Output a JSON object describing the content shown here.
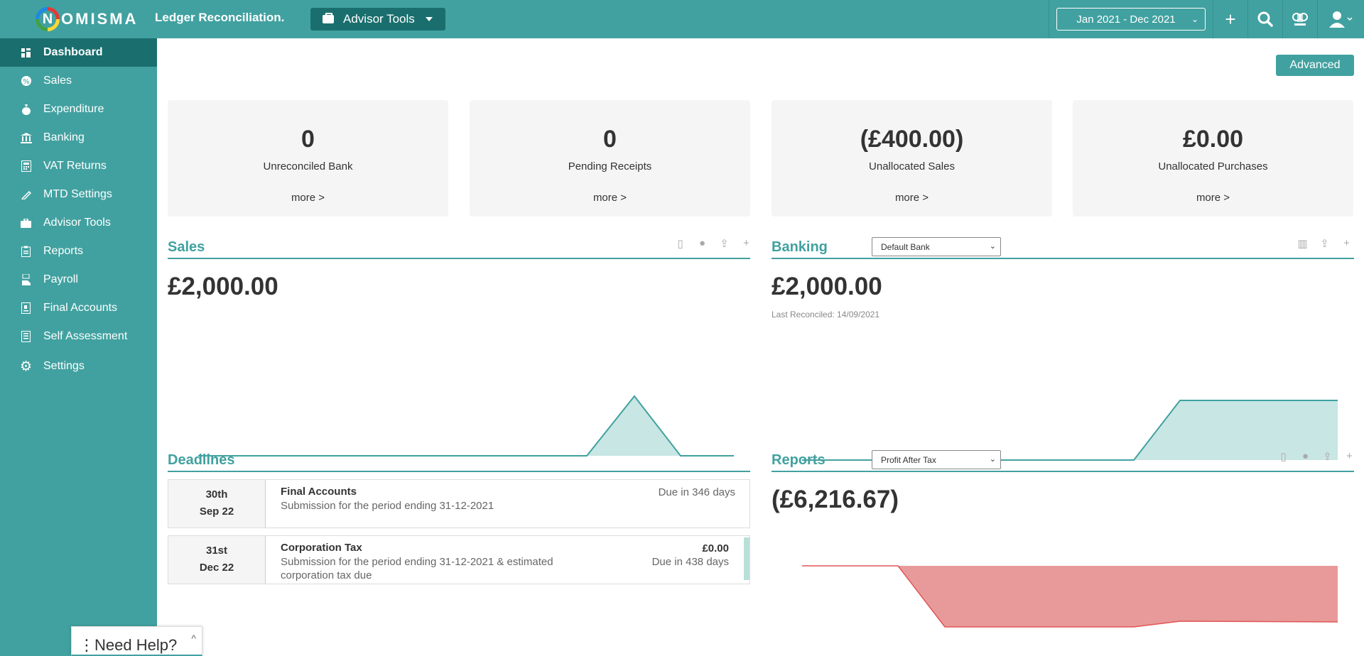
{
  "header": {
    "logo_letter": "N",
    "logo_text": "OMISMA",
    "app_title": "Ledger Reconciliation.",
    "advisor_tools": "Advisor Tools",
    "date_range": "Jan 2021 - Dec 2021"
  },
  "sidebar": {
    "items": [
      {
        "label": "Dashboard",
        "icon": "grid-icon"
      },
      {
        "label": "Sales",
        "icon": "percent-icon"
      },
      {
        "label": "Expenditure",
        "icon": "money-bag-icon"
      },
      {
        "label": "Banking",
        "icon": "bank-icon"
      },
      {
        "label": "VAT Returns",
        "icon": "calculator-icon"
      },
      {
        "label": "MTD Settings",
        "icon": "pen-icon"
      },
      {
        "label": "Advisor Tools",
        "icon": "briefcase-icon"
      },
      {
        "label": "Reports",
        "icon": "clipboard-icon"
      },
      {
        "label": "Payroll",
        "icon": "hand-money-icon"
      },
      {
        "label": "Final Accounts",
        "icon": "document-icon"
      },
      {
        "label": "Self Assessment",
        "icon": "form-icon"
      },
      {
        "label": "Settings",
        "icon": "gear-icon"
      }
    ]
  },
  "main": {
    "advanced_label": "Advanced",
    "stats": [
      {
        "value": "0",
        "label": "Unreconciled Bank",
        "more": "more >"
      },
      {
        "value": "0",
        "label": "Pending Receipts",
        "more": "more >"
      },
      {
        "value": "(£400.00)",
        "label": "Unallocated Sales",
        "more": "more >"
      },
      {
        "value": "£0.00",
        "label": "Unallocated Purchases",
        "more": "more >"
      }
    ],
    "sales": {
      "title": "Sales",
      "value": "£2,000.00"
    },
    "banking": {
      "title": "Banking",
      "select": "Default Bank",
      "value": "£2,000.00",
      "note": "Last Reconciled: 14/09/2021"
    },
    "deadlines": {
      "title": "Deadlines",
      "items": [
        {
          "day": "30th",
          "month": "Sep 22",
          "title": "Final Accounts",
          "desc": "Submission for the period ending 31-12-2021",
          "amount": "",
          "due": "Due in 346 days"
        },
        {
          "day": "31st",
          "month": "Dec 22",
          "title": "Corporation Tax",
          "desc": "Submission for the period ending 31-12-2021 & estimated corporation tax due",
          "amount": "£0.00",
          "due": "Due in 438 days"
        }
      ]
    },
    "reports": {
      "title": "Reports",
      "select": "Profit After Tax",
      "value": "(£6,216.67)"
    }
  },
  "help": {
    "label": "Need Help?"
  },
  "colors": {
    "accent": "#41a1a0",
    "accent_dark": "#1a6f6e",
    "positive_fill": "#c8e6e3",
    "negative_fill": "#e89a9a",
    "negative_line": "#e05555"
  }
}
